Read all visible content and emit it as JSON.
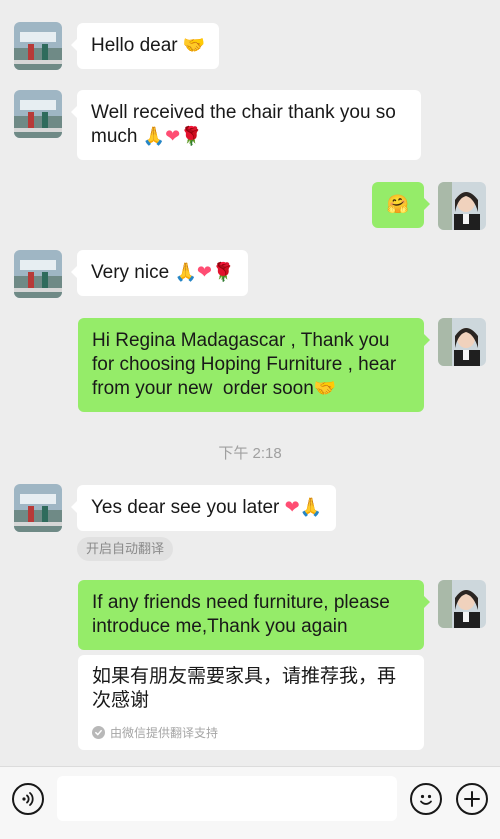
{
  "messages": [
    {
      "id": "m1",
      "side": "in",
      "text": "Hello dear",
      "emoji": "🤝"
    },
    {
      "id": "m2",
      "side": "in",
      "line1": "Well received the chair thank you so",
      "line2": "much",
      "emoji": [
        "🙏",
        "❤",
        "🌹"
      ]
    },
    {
      "id": "m3",
      "side": "out",
      "emoji": "🤗"
    },
    {
      "id": "m4",
      "side": "in",
      "text": "Very nice",
      "emoji": [
        "🙏",
        "❤",
        "🌹"
      ]
    },
    {
      "id": "m5",
      "side": "out",
      "line1": "Hi Regina Madagascar , Thank you",
      "line2": "for choosing Hoping Furniture , hear",
      "line3": "from your new  order soon",
      "emoji": "🤝"
    },
    {
      "id": "m6",
      "side": "in",
      "text": "Yes dear see you later",
      "emoji": [
        "❤",
        "🙏"
      ]
    },
    {
      "id": "m7",
      "side": "out",
      "line1": "If any friends need furniture, please",
      "line2": "introduce me,Thank you again"
    }
  ],
  "timestamp": "下午 2:18",
  "auto_translate_label": "开启自动翻译",
  "translation": {
    "line1": "如果有朋友需要家具，请推荐我，再",
    "line2": "次感谢",
    "source": "由微信提供翻译支持"
  },
  "toolbar": {
    "voice_icon": "voice-icon",
    "emoji_icon": "emoji-icon",
    "plus_icon": "plus-icon"
  },
  "colors": {
    "background": "#ededed",
    "incoming_bubble": "#ffffff",
    "outgoing_bubble": "#95ec69",
    "timestamp": "#a0a0a0"
  }
}
